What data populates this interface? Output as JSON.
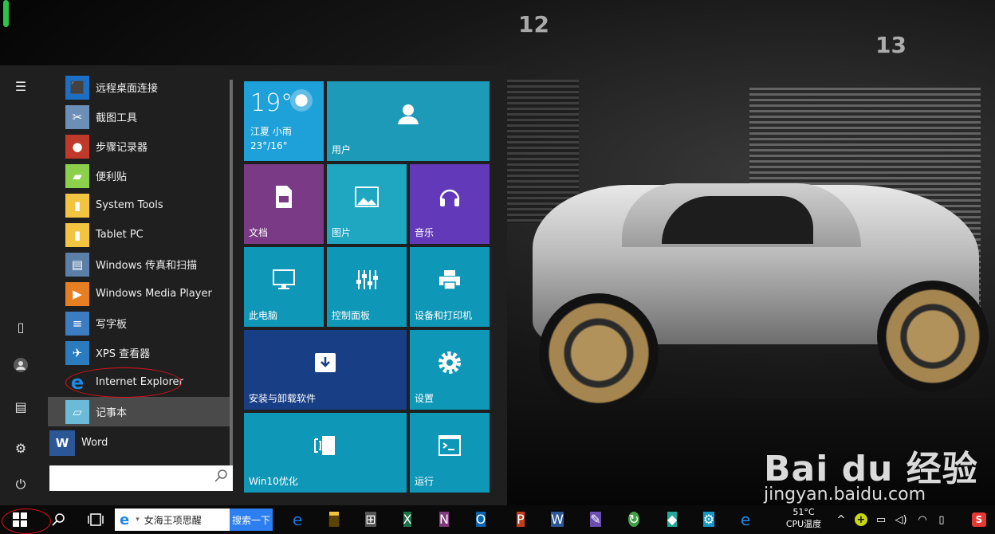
{
  "start_menu": {
    "rail": {
      "hamburger_icon": "☰",
      "tablet_icon": "▯",
      "user_icon": "●",
      "explorer_icon": "▤",
      "settings_icon": "⚙",
      "power_icon": "⏻"
    },
    "apps": [
      {
        "label": "远程桌面连接",
        "icon": "remote-desktop-icon",
        "color": "#1c6fc4"
      },
      {
        "label": "截图工具",
        "icon": "snipping-tool-icon",
        "color": "#6b8fb7"
      },
      {
        "label": "步骤记录器",
        "icon": "steps-recorder-icon",
        "color": "#c0392b"
      },
      {
        "label": "便利贴",
        "icon": "sticky-notes-icon",
        "color": "#8ccf4b"
      },
      {
        "label": "System Tools",
        "icon": "folder-icon",
        "color": "#f3c440"
      },
      {
        "label": "Tablet PC",
        "icon": "folder-icon",
        "color": "#f3c440"
      },
      {
        "label": "Windows 传真和扫描",
        "icon": "fax-scan-icon",
        "color": "#5c7fa8"
      },
      {
        "label": "Windows Media Player",
        "icon": "media-player-icon",
        "color": "#e67e22"
      },
      {
        "label": "写字板",
        "icon": "wordpad-icon",
        "color": "#3b7dc0"
      },
      {
        "label": "XPS 查看器",
        "icon": "xps-viewer-icon",
        "color": "#2a7cbf"
      },
      {
        "label": "Internet Explorer",
        "icon": "internet-explorer-icon",
        "color": "#1e88e5"
      },
      {
        "label": "记事本",
        "icon": "notepad-icon",
        "color": "#6bbad8"
      },
      {
        "label": "Word",
        "icon": "word-icon",
        "color": "#2b5797"
      }
    ],
    "search_placeholder": ""
  },
  "tiles": {
    "weather": {
      "temp": "19°",
      "city": "江夏 小雨",
      "range": "23°/16°",
      "color": "#1ea0d9"
    },
    "user": {
      "label": "用户",
      "icon": "user-icon",
      "color": "#1d9ab8"
    },
    "docs": {
      "label": "文档",
      "icon": "document-icon",
      "color": "#7b3a86"
    },
    "pictures": {
      "label": "图片",
      "icon": "picture-icon",
      "color": "#1fa6c0"
    },
    "music": {
      "label": "音乐",
      "icon": "headphones-icon",
      "color": "#6239b8"
    },
    "pc": {
      "label": "此电脑",
      "icon": "monitor-icon",
      "color": "#0f97b8"
    },
    "control_panel": {
      "label": "控制面板",
      "icon": "sliders-icon",
      "color": "#0f97b8"
    },
    "devices": {
      "label": "设备和打印机",
      "icon": "printer-icon",
      "color": "#0f97b8"
    },
    "install": {
      "label": "安装与卸载软件",
      "icon": "install-icon",
      "color": "#183f86"
    },
    "settings": {
      "label": "设置",
      "icon": "gear-icon",
      "color": "#0f97b8"
    },
    "win10": {
      "label": "Win10优化",
      "icon": "optimize-icon",
      "color": "#0f97b8"
    },
    "run": {
      "label": "运行",
      "icon": "run-icon",
      "color": "#0f97b8"
    }
  },
  "taskbar": {
    "search_text": "女海王项思醒",
    "search_button": "搜索一下",
    "cpu_temp": "51°C",
    "cpu_label": "CPU温度",
    "apps": [
      {
        "name": "edge",
        "glyph": "e",
        "color": "#1a73d9"
      },
      {
        "name": "file-explorer",
        "glyph": "▆",
        "color": "#f3c440"
      },
      {
        "name": "store",
        "glyph": "⊞",
        "color": "#555555"
      },
      {
        "name": "excel",
        "glyph": "X",
        "color": "#1e7145"
      },
      {
        "name": "onenote",
        "glyph": "N",
        "color": "#80397b"
      },
      {
        "name": "outlook",
        "glyph": "O",
        "color": "#0a64ad"
      },
      {
        "name": "powerpoint",
        "glyph": "P",
        "color": "#c43e1c"
      },
      {
        "name": "word",
        "glyph": "W",
        "color": "#2b5797"
      },
      {
        "name": "paint",
        "glyph": "✎",
        "color": "#6a4fb0"
      },
      {
        "name": "green-app",
        "glyph": "↻",
        "color": "#43a047"
      },
      {
        "name": "photo-app",
        "glyph": "◆",
        "color": "#26a69a"
      },
      {
        "name": "settings-app",
        "glyph": "⚙",
        "color": "#1298c4"
      },
      {
        "name": "internet-explorer",
        "glyph": "e",
        "color": "#1e88e5"
      }
    ],
    "tray": {
      "chevron": "^",
      "security": "+",
      "battery": "▭",
      "network": "⎍",
      "volume": "◁)",
      "keyboard": "⌨",
      "wifi": "◠",
      "monitor": "▯",
      "sogou": "S"
    }
  },
  "watermark": {
    "logo": "Bai du 经验",
    "url": "jingyan.baidu.com"
  },
  "wallpaper": {
    "bay_left": "12",
    "bay_right": "13"
  }
}
